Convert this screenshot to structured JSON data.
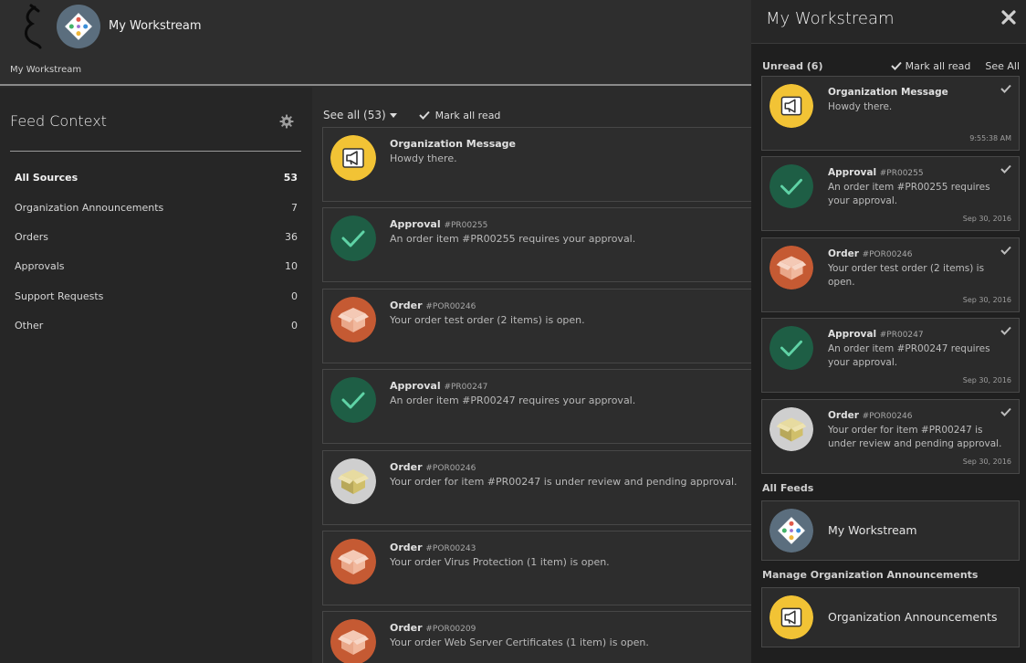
{
  "header": {
    "title": "My Workstream",
    "breadcrumb": "My Workstream"
  },
  "sidebar": {
    "title": "Feed Context",
    "items": [
      {
        "label": "All Sources",
        "count": "53"
      },
      {
        "label": "Organization Announcements",
        "count": "7"
      },
      {
        "label": "Orders",
        "count": "36"
      },
      {
        "label": "Approvals",
        "count": "10"
      },
      {
        "label": "Support Requests",
        "count": "0"
      },
      {
        "label": "Other",
        "count": "0"
      }
    ]
  },
  "feed": {
    "see_all": "See all (53)",
    "mark_all_read": "Mark all read",
    "cards": [
      {
        "type": "announcement",
        "title": "Organization Message",
        "id": "",
        "body": "Howdy there."
      },
      {
        "type": "approval",
        "title": "Approval",
        "id": "#PR00255",
        "body": "An order item #PR00255 requires your approval."
      },
      {
        "type": "order",
        "title": "Order",
        "id": "#POR00246",
        "body": "Your order test order (2 items) is open."
      },
      {
        "type": "approval",
        "title": "Approval",
        "id": "#PR00247",
        "body": "An order item #PR00247 requires your approval."
      },
      {
        "type": "order-pending",
        "title": "Order",
        "id": "#POR00246",
        "body": "Your order for item #PR00247 is under review and pending approval."
      },
      {
        "type": "order",
        "title": "Order",
        "id": "#POR00243",
        "body": "Your order Virus Protection (1 item) is open."
      },
      {
        "type": "order",
        "title": "Order",
        "id": "#POR00209",
        "body": "Your order Web Server Certificates (1 item) is open."
      }
    ]
  },
  "panel": {
    "title": "My Workstream",
    "unread_label": "Unread (6)",
    "mark_all_read": "Mark all read",
    "see_all": "See All",
    "cards": [
      {
        "type": "announcement",
        "title": "Organization Message",
        "id": "",
        "body": "Howdy there.",
        "time": "9:55:38 AM"
      },
      {
        "type": "approval",
        "title": "Approval",
        "id": "#PR00255",
        "body": "An order item #PR00255 requires your approval.",
        "time": "Sep 30, 2016"
      },
      {
        "type": "order",
        "title": "Order",
        "id": "#POR00246",
        "body": "Your order test order (2 items) is open.",
        "time": "Sep 30, 2016"
      },
      {
        "type": "approval",
        "title": "Approval",
        "id": "#PR00247",
        "body": "An order item #PR00247 requires your approval.",
        "time": "Sep 30, 2016"
      },
      {
        "type": "order-pending",
        "title": "Order",
        "id": "#POR00246",
        "body": "Your order for item #PR00247 is under review and pending approval.",
        "time": "Sep 30, 2016"
      }
    ],
    "all_feeds_label": "All Feeds",
    "all_feeds_item": "My Workstream",
    "manage_label": "Manage Organization Announcements",
    "manage_item": "Organization Announcements"
  },
  "colors": {
    "announcement": "#f2c335",
    "approval": "#1e5e45",
    "order": "#c55a33",
    "order_pending": "#c9c9c9"
  }
}
